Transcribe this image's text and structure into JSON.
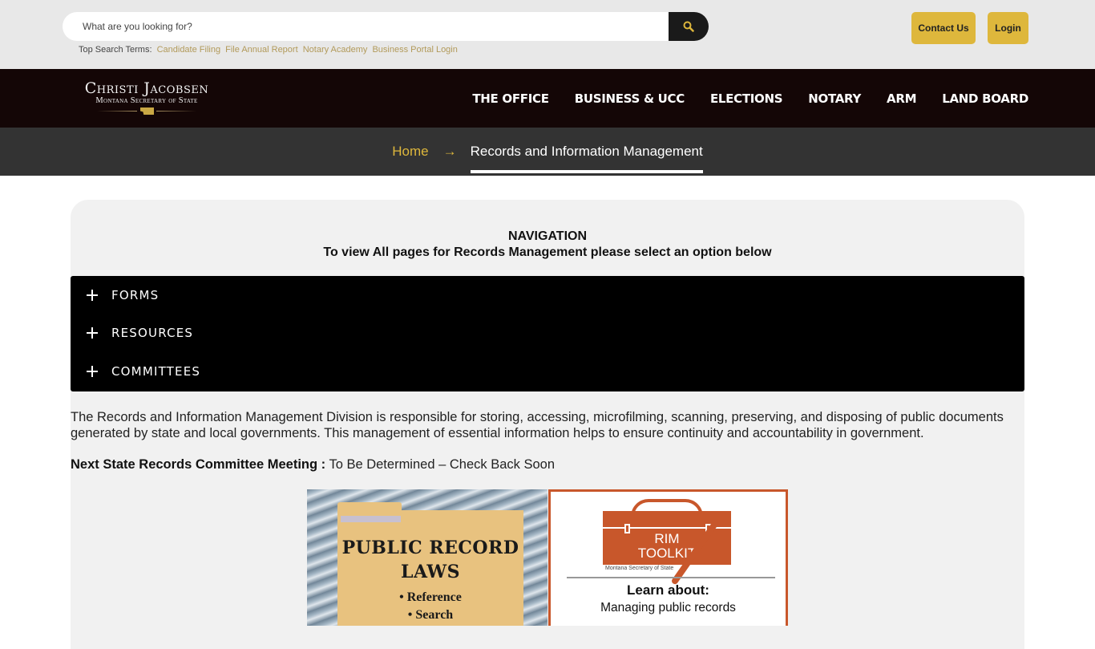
{
  "search": {
    "placeholder": "What are you looking for?",
    "top_terms_label": "Top Search Terms:",
    "top_terms": [
      "Candidate Filing",
      "File Annual Report",
      "Notary Academy",
      "Business Portal Login"
    ]
  },
  "utility": {
    "contact_label": "Contact Us",
    "login_label": "Login"
  },
  "logo": {
    "name": "Christi Jacobsen",
    "subtitle": "Montana Secretary of State"
  },
  "nav": {
    "items": [
      "THE OFFICE",
      "BUSINESS & UCC",
      "ELECTIONS",
      "NOTARY",
      "ARM",
      "LAND BOARD"
    ]
  },
  "breadcrumb": {
    "home": "Home",
    "separator": "→",
    "current": "Records and Information Management"
  },
  "content": {
    "nav_heading": "NAVIGATION",
    "nav_subheading": "To view All pages for Records Management please select an option below",
    "accordion": [
      "FORMS",
      "RESOURCES",
      "COMMITTEES"
    ],
    "description": "The Records and Information Management Division is responsible for storing, accessing, microfilming, scanning, preserving, and disposing of public documents generated by state and local governments. This management of essential information helps to ensure continuity and accountability in government.",
    "meeting_label": "Next State Records Committee Meeting :",
    "meeting_value": " To Be Determined – Check Back Soon"
  },
  "images": {
    "laws": {
      "title_line1": "PUBLIC RECORD",
      "title_line2": "LAWS",
      "bullet1": "• Reference",
      "bullet2": "• Search"
    },
    "toolkit": {
      "title_line1": "RIM",
      "title_line2": "TOOLKIT",
      "org": "Montana Secretary of State",
      "learn": "Learn about:",
      "topic": "Managing public records"
    }
  },
  "colors": {
    "accent_gold": "#deb73c",
    "nav_bg": "#140606",
    "breadcrumb_bg": "#333333",
    "toolkit_orange": "#c8572b"
  }
}
